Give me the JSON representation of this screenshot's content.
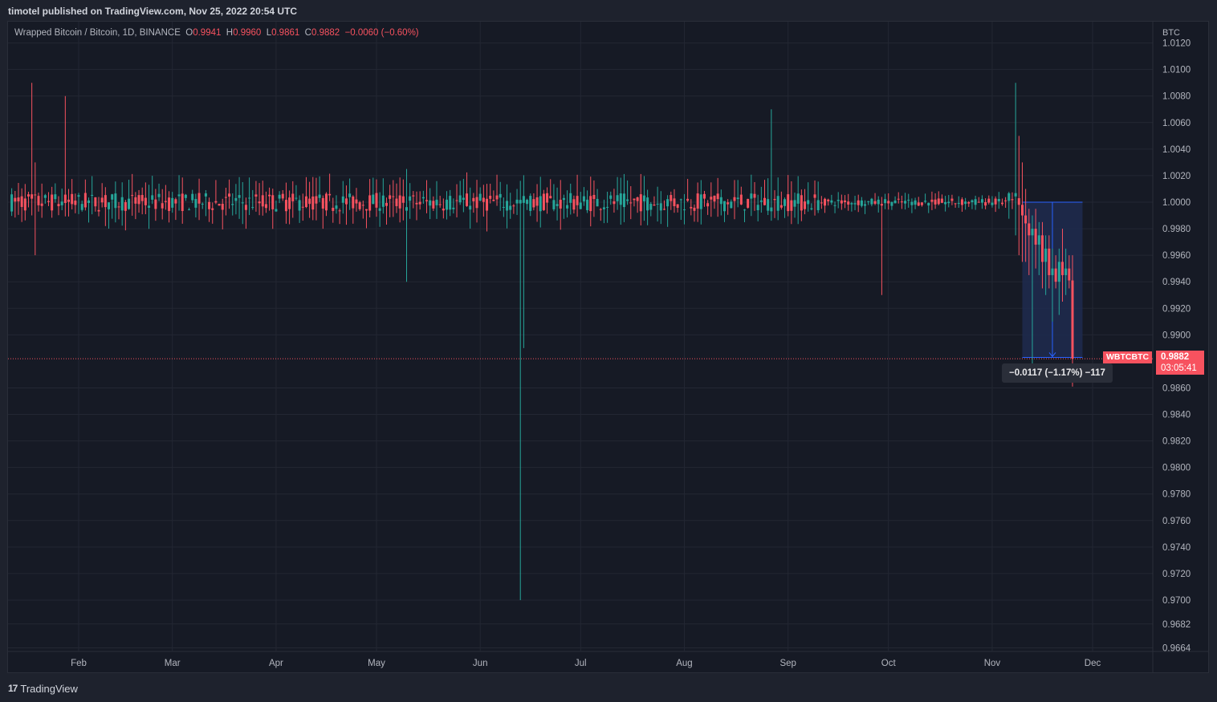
{
  "header": {
    "published": "timotel published on TradingView.com, Nov 25, 2022 20:54 UTC"
  },
  "legend": {
    "symbol": "Wrapped Bitcoin / Bitcoin, 1D, BINANCE",
    "open_label": "O",
    "open": "0.9941",
    "high_label": "H",
    "high": "0.9960",
    "low_label": "L",
    "low": "0.9861",
    "close_label": "C",
    "close": "0.9882",
    "change": "−0.0060 (−0.60%)"
  },
  "price_axis": {
    "currency": "BTC"
  },
  "last_price": {
    "symbol": "WBTCBTC",
    "price": "0.9882",
    "countdown": "03:05:41"
  },
  "measure": {
    "label": "−0.0117 (−1.17%) −117"
  },
  "footer": {
    "brand": "TradingView",
    "logo": "17"
  },
  "colors": {
    "up": "#26a69a",
    "down": "#f7525f",
    "grid": "#232733",
    "text": "#b2b5be",
    "measure_fill": "#1e2c4f",
    "measure_line": "#2962ff"
  },
  "chart_data": {
    "type": "candlestick",
    "title": "Wrapped Bitcoin / Bitcoin, 1D, BINANCE",
    "y_unit": "BTC",
    "ylim": [
      0.9664,
      1.012
    ],
    "yticks": [
      "1.0120",
      "1.0100",
      "1.0080",
      "1.0060",
      "1.0040",
      "1.0020",
      "1.0000",
      "0.9980",
      "0.9960",
      "0.9940",
      "0.9920",
      "0.9900",
      "0.9860",
      "0.9840",
      "0.9820",
      "0.9800",
      "0.9780",
      "0.9760",
      "0.9740",
      "0.9720",
      "0.9700",
      "0.9682",
      "0.9664"
    ],
    "x_range": [
      "2022-01-12",
      "2022-12-14"
    ],
    "xticks": [
      {
        "label": "Feb",
        "date": "2022-02-01"
      },
      {
        "label": "Mar",
        "date": "2022-03-01"
      },
      {
        "label": "Apr",
        "date": "2022-04-01"
      },
      {
        "label": "May",
        "date": "2022-05-01"
      },
      {
        "label": "Jun",
        "date": "2022-06-01"
      },
      {
        "label": "Jul",
        "date": "2022-07-01"
      },
      {
        "label": "Aug",
        "date": "2022-08-01"
      },
      {
        "label": "Sep",
        "date": "2022-09-01"
      },
      {
        "label": "Oct",
        "date": "2022-10-01"
      },
      {
        "label": "Nov",
        "date": "2022-11-01"
      },
      {
        "label": "Dec",
        "date": "2022-12-01"
      }
    ],
    "grid": true,
    "last_price_line": 0.9882,
    "notable_wicks": [
      {
        "date": "2022-01-18",
        "high": 1.009,
        "low": 0.999
      },
      {
        "date": "2022-01-19",
        "high": 1.003,
        "low": 0.996
      },
      {
        "date": "2022-01-28",
        "high": 1.008,
        "low": 0.999
      },
      {
        "date": "2022-05-10",
        "high": 1.0025,
        "low": 0.994
      },
      {
        "date": "2022-06-13",
        "high": 1.0015,
        "low": 0.97
      },
      {
        "date": "2022-06-14",
        "high": 1.001,
        "low": 0.989
      },
      {
        "date": "2022-08-27",
        "high": 1.007,
        "low": 0.9995
      },
      {
        "date": "2022-09-29",
        "high": 1.0,
        "low": 0.993
      },
      {
        "date": "2022-11-08",
        "high": 1.009,
        "low": 0.9975
      },
      {
        "date": "2022-11-09",
        "high": 1.005,
        "low": 0.996
      }
    ],
    "recent_candles": [
      {
        "date": "2022-11-09",
        "open": 1.0003,
        "high": 1.005,
        "low": 0.996,
        "close": 0.9998
      },
      {
        "date": "2022-11-10",
        "open": 0.9998,
        "high": 1.003,
        "low": 0.9955,
        "close": 0.999
      },
      {
        "date": "2022-11-11",
        "open": 0.999,
        "high": 1.001,
        "low": 0.9955,
        "close": 0.9984
      },
      {
        "date": "2022-11-12",
        "open": 0.9984,
        "high": 0.9995,
        "low": 0.9945,
        "close": 0.9975
      },
      {
        "date": "2022-11-13",
        "open": 0.9975,
        "high": 0.999,
        "low": 0.987,
        "close": 0.998
      },
      {
        "date": "2022-11-14",
        "open": 0.998,
        "high": 0.9995,
        "low": 0.995,
        "close": 0.9968
      },
      {
        "date": "2022-11-15",
        "open": 0.9968,
        "high": 0.9985,
        "low": 0.9945,
        "close": 0.9975
      },
      {
        "date": "2022-11-16",
        "open": 0.9975,
        "high": 0.9985,
        "low": 0.9935,
        "close": 0.9955
      },
      {
        "date": "2022-11-17",
        "open": 0.9955,
        "high": 0.9975,
        "low": 0.993,
        "close": 0.9965
      },
      {
        "date": "2022-11-18",
        "open": 0.9965,
        "high": 0.9975,
        "low": 0.9935,
        "close": 0.9945
      },
      {
        "date": "2022-11-19",
        "open": 0.9945,
        "high": 0.9965,
        "low": 0.991,
        "close": 0.995
      },
      {
        "date": "2022-11-20",
        "open": 0.995,
        "high": 0.996,
        "low": 0.9935,
        "close": 0.994
      },
      {
        "date": "2022-11-21",
        "open": 0.994,
        "high": 0.9965,
        "low": 0.9915,
        "close": 0.9955
      },
      {
        "date": "2022-11-22",
        "open": 0.9955,
        "high": 0.998,
        "low": 0.9925,
        "close": 0.9945
      },
      {
        "date": "2022-11-23",
        "open": 0.9945,
        "high": 0.9965,
        "low": 0.993,
        "close": 0.995
      },
      {
        "date": "2022-11-24",
        "open": 0.995,
        "high": 0.996,
        "low": 0.9935,
        "close": 0.9941
      },
      {
        "date": "2022-11-25",
        "open": 0.9941,
        "high": 0.996,
        "low": 0.9861,
        "close": 0.9882
      }
    ],
    "measure_tool": {
      "from_date": "2022-11-10",
      "to_date": "2022-11-28",
      "from_price": 1.0,
      "to_price": 0.9883,
      "change": -0.0117,
      "change_pct": -1.17,
      "ticks": -117
    }
  }
}
